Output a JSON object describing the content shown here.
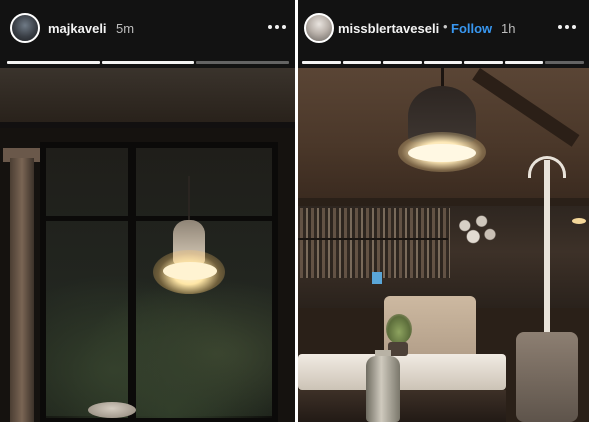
{
  "stories": [
    {
      "username": "majkaveli",
      "timestamp": "5m",
      "progress_segments": 3,
      "completed_segments": 2
    },
    {
      "username": "missblertaveseli",
      "bullet": "•",
      "follow_label": "Follow",
      "timestamp": "1h",
      "progress_segments": 7,
      "completed_segments": 6
    }
  ],
  "colors": {
    "follow": "#3897f0",
    "header_background": "#121212",
    "progress_done": "#f3f3f3"
  },
  "icons": {
    "more": "more-horizontal-icon"
  }
}
